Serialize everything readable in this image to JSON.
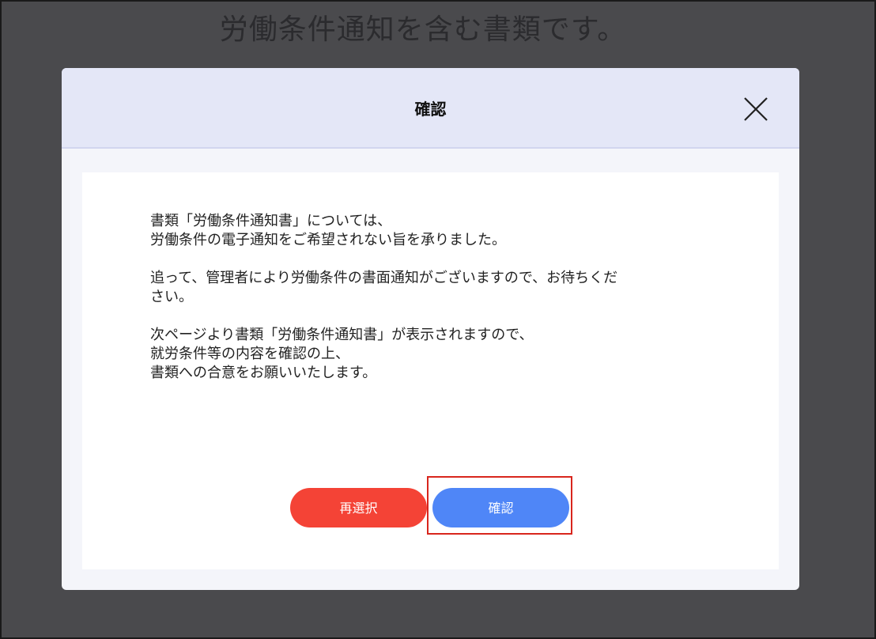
{
  "background": {
    "title": "労働条件通知を含む書類です。"
  },
  "modal": {
    "title": "確認",
    "close_icon": "close-x-icon",
    "message": {
      "paragraph1": "書類「労働条件通知書」については、\n労働条件の電子通知をご希望されない旨を承りました。",
      "paragraph2": "追って、管理者により労働条件の書面通知がございますので、お待ちくだ\nさい。",
      "paragraph3": "次ページより書類「労働条件通知書」が表示されますので、\n就労条件等の内容を確認の上、\n書類への合意をお願いいたします。"
    },
    "buttons": {
      "reselect_label": "再選択",
      "confirm_label": "確認"
    }
  },
  "colors": {
    "reselect": "#f44336",
    "confirm": "#4f86f7",
    "highlight": "#d8261d",
    "header_bg": "#e4e7f7"
  }
}
